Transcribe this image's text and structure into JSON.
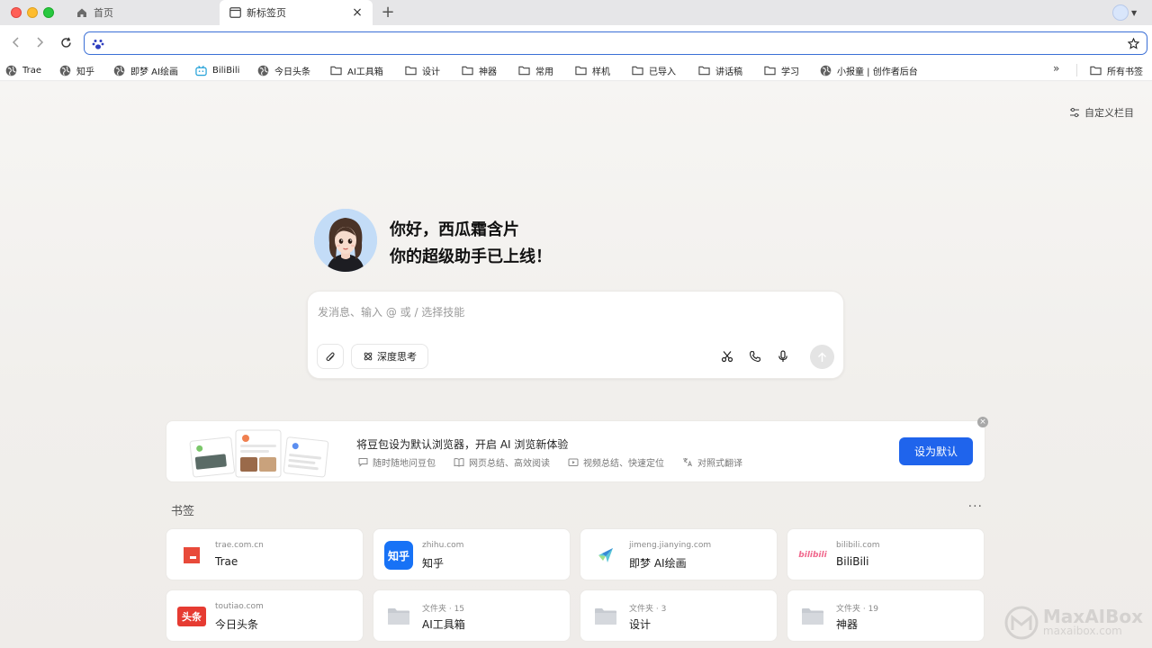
{
  "tabs": [
    {
      "title": "首页",
      "icon": "home-icon",
      "active": false
    },
    {
      "title": "新标签页",
      "icon": "newtab-page-icon",
      "active": true
    }
  ],
  "toolbar": {
    "address_value": "",
    "address_icon": "baidu-paw-icon"
  },
  "bookmarks_bar": {
    "items": [
      {
        "label": "Trae",
        "icon": "globe-icon"
      },
      {
        "label": "知乎",
        "icon": "globe-icon"
      },
      {
        "label": "即梦 AI绘画",
        "icon": "globe-icon"
      },
      {
        "label": "BiliBili",
        "icon": "bilibili-icon"
      },
      {
        "label": "今日头条",
        "icon": "globe-icon"
      },
      {
        "label": "AI工具箱",
        "icon": "folder-icon"
      },
      {
        "label": "设计",
        "icon": "folder-icon"
      },
      {
        "label": "神器",
        "icon": "folder-icon"
      },
      {
        "label": "常用",
        "icon": "folder-icon"
      },
      {
        "label": "样机",
        "icon": "folder-icon"
      },
      {
        "label": "已导入",
        "icon": "folder-icon"
      },
      {
        "label": "讲话稿",
        "icon": "folder-icon"
      },
      {
        "label": "学习",
        "icon": "folder-icon"
      },
      {
        "label": "小报童 | 创作者后台",
        "icon": "globe-icon"
      }
    ],
    "more_label": "»",
    "all_bookmarks_label": "所有书签"
  },
  "main": {
    "customize_label": "自定义栏目",
    "greeting_line1": "你好，西瓜霜含片",
    "greeting_line2": "你的超级助手已上线！",
    "chat": {
      "placeholder": "发消息、输入 @ 或 / 选择技能",
      "deep_think_label": "深度思考"
    },
    "promo": {
      "title": "将豆包设为默认浏览器，开启 AI 浏览新体验",
      "features": [
        {
          "label": "随时随地问豆包",
          "icon": "chat-bubble-icon"
        },
        {
          "label": "网页总结、高效阅读",
          "icon": "book-icon"
        },
        {
          "label": "视频总结、快速定位",
          "icon": "video-icon"
        },
        {
          "label": "对照式翻译",
          "icon": "translate-icon"
        }
      ],
      "cta_label": "设为默认",
      "close_label": "×"
    },
    "bookmarks_section": {
      "title": "书签",
      "more_label": "···",
      "cards": [
        {
          "sub": "trae.com.cn",
          "name": "Trae",
          "icon": "trae-logo"
        },
        {
          "sub": "zhihu.com",
          "name": "知乎",
          "icon": "zhihu-logo",
          "icon_text": "知乎"
        },
        {
          "sub": "jimeng.jianying.com",
          "name": "即梦 AI绘画",
          "icon": "jimeng-logo"
        },
        {
          "sub": "bilibili.com",
          "name": "BiliBili",
          "icon": "bilibili-logo",
          "icon_text": "bilibili"
        },
        {
          "sub": "toutiao.com",
          "name": "今日头条",
          "icon": "toutiao-logo",
          "icon_text": "头条"
        },
        {
          "sub": "文件夹 · 15",
          "name": "AI工具箱",
          "icon": "folder-icon"
        },
        {
          "sub": "文件夹 · 3",
          "name": "设计",
          "icon": "folder-icon"
        },
        {
          "sub": "文件夹 · 19",
          "name": "神器",
          "icon": "folder-icon"
        }
      ]
    }
  },
  "watermark": {
    "title": "MaxAIBox",
    "sub": "maxaibox.com"
  },
  "colors": {
    "accent": "#1f64ec",
    "focus_ring": "#3a6fd6",
    "trae_red": "#e84a3a",
    "zhihu_blue": "#1772f6",
    "toutiao_red": "#e63b32"
  }
}
